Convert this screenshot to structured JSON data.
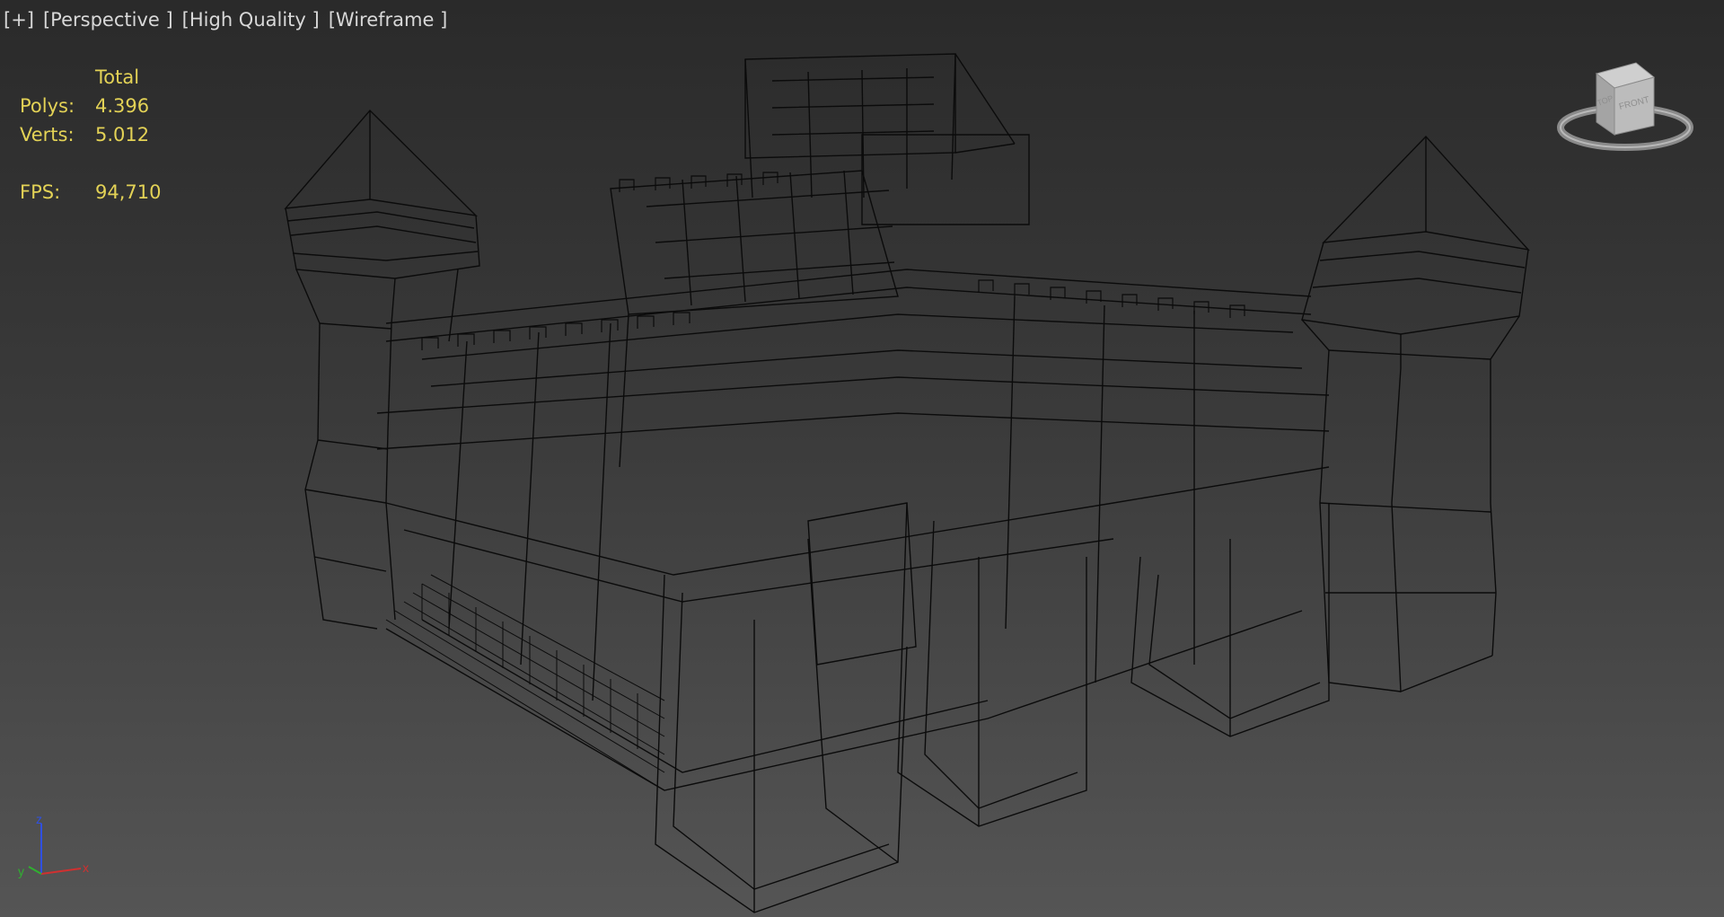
{
  "viewport": {
    "labels": [
      "[+]",
      "[Perspective ]",
      "[High Quality ]",
      "[Wireframe ]"
    ]
  },
  "stats": {
    "header": "Total",
    "polys_label": "Polys:",
    "polys_value": "4.396",
    "verts_label": "Verts:",
    "verts_value": "5.012",
    "fps_label": "FPS:",
    "fps_value": "94,710"
  },
  "viewcube": {
    "top_label": "TOP",
    "front_label": "FRONT"
  },
  "axes": {
    "z": "z",
    "y": "y",
    "x": "x"
  },
  "colors": {
    "stats_text": "#e3d256",
    "wire": "#0b0b0b",
    "axis_x": "#d03030",
    "axis_y": "#30b030",
    "axis_z": "#3050e0"
  }
}
